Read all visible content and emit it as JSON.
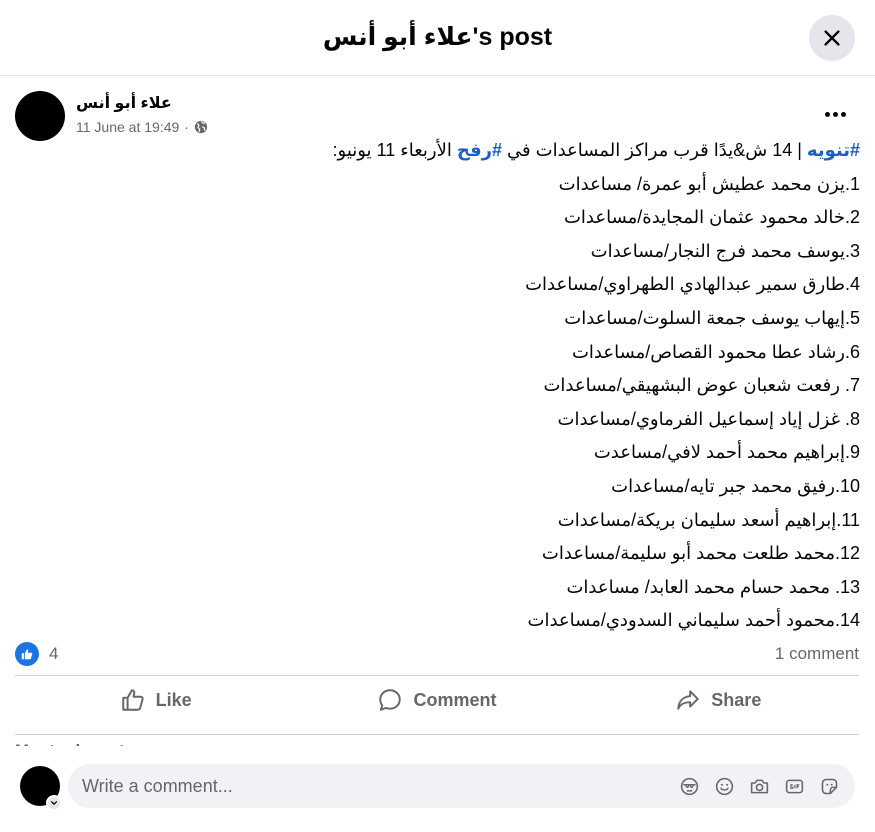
{
  "header": {
    "title": "علاء أبو أنس's post"
  },
  "post": {
    "author": "علاء أبو أنس",
    "timestamp": "11 June at 19:49",
    "separator": "·",
    "privacy_icon": "globe-icon",
    "intro": {
      "hashtag1": "#تنويه",
      "text1": " | 14 ش&يدًا قرب مراكز المساعدات في ",
      "hashtag2": "#رفح",
      "text2": " الأربعاء 11 يونيو:"
    },
    "lines": [
      "1.يزن محمد عطيش أبو عمرة/ مساعدات",
      "2.خالد محمود عثمان المجايدة/مساعدات",
      "3.يوسف محمد فرج النجار/مساعدات",
      "4.طارق سمير عبدالهادي الطهراوي/مساعدات",
      "5.إيهاب يوسف جمعة السلوت/مساعدات",
      "6.رشاد عطا محمود القصاص/مساعدات",
      "7. رفعت شعبان عوض البشهيقي/مساعدات",
      "8. غزل إياد إسماعيل الفرماوي/مساعدات",
      "9.إبراهيم محمد أحمد لافي/مساعدت",
      "10.رفيق محمد جبر تايه/مساعدات",
      "11.إبراهيم أسعد سليمان بريكة/مساعدات",
      "12.محمد طلعت محمد أبو سليمة/مساعدات",
      "13. محمد حسام محمد العابد/ مساعدات",
      "14.محمود أحمد سليماني السدودي/مساعدات"
    ]
  },
  "reactions": {
    "count": "4",
    "comments": "1 comment"
  },
  "actions": {
    "like": "Like",
    "comment": "Comment",
    "share": "Share"
  },
  "partial_text": "Most relevant",
  "composer": {
    "placeholder": "Write a comment..."
  },
  "colors": {
    "accent": "#1b74e4",
    "hashtag": "#1a5fc7",
    "muted": "#65676b",
    "surface": "#f0f2f5"
  }
}
